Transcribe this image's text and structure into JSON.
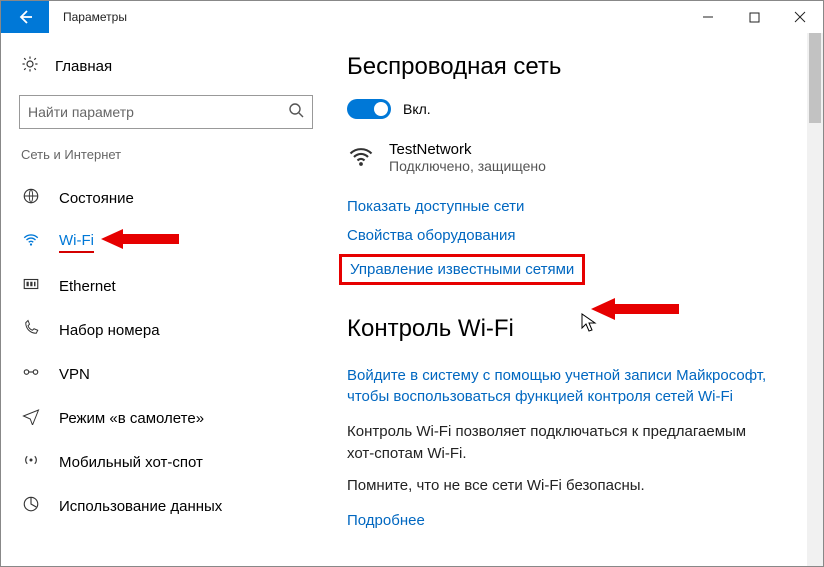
{
  "window": {
    "title": "Параметры"
  },
  "sidebar": {
    "home": "Главная",
    "search_placeholder": "Найти параметр",
    "category": "Сеть и Интернет",
    "items": [
      {
        "icon": "status",
        "label": "Состояние"
      },
      {
        "icon": "wifi",
        "label": "Wi-Fi"
      },
      {
        "icon": "ethernet",
        "label": "Ethernet"
      },
      {
        "icon": "dialup",
        "label": "Набор номера"
      },
      {
        "icon": "vpn",
        "label": "VPN"
      },
      {
        "icon": "airplane",
        "label": "Режим «в самолете»"
      },
      {
        "icon": "hotspot",
        "label": "Мобильный хот-спот"
      },
      {
        "icon": "datausage",
        "label": "Использование данных"
      }
    ]
  },
  "main": {
    "heading": "Беспроводная сеть",
    "toggle_label": "Вкл.",
    "network": {
      "name": "TestNetwork",
      "status": "Подключено, защищено"
    },
    "link_show_networks": "Показать доступные сети",
    "link_hw_props": "Свойства оборудования",
    "link_manage": "Управление известными сетями",
    "wifi_control": {
      "heading": "Контроль Wi-Fi",
      "link_signin": "Войдите в систему с помощью учетной записи Майкрософт, чтобы воспользоваться функцией контроля сетей Wi-Fi",
      "para1": "Контроль Wi-Fi позволяет подключаться к предлагаемым хот-спотам Wi-Fi.",
      "para2": "Помните, что не все сети Wi-Fi безопасны.",
      "link_more": "Подробнее"
    }
  }
}
